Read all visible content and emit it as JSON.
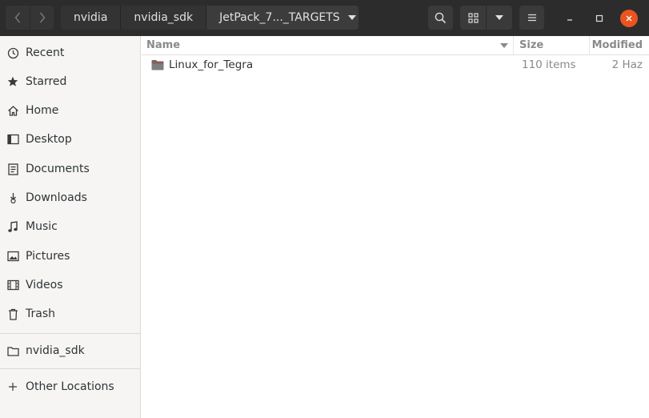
{
  "pathbar": {
    "crumbs": [
      "nvidia",
      "nvidia_sdk",
      "JetPack_7..._TARGETS"
    ]
  },
  "sidebar": {
    "items": [
      {
        "label": "Recent",
        "icon": "clock-icon"
      },
      {
        "label": "Starred",
        "icon": "star-icon"
      },
      {
        "label": "Home",
        "icon": "home-icon"
      },
      {
        "label": "Desktop",
        "icon": "desktop-icon"
      },
      {
        "label": "Documents",
        "icon": "document-icon"
      },
      {
        "label": "Downloads",
        "icon": "download-icon"
      },
      {
        "label": "Music",
        "icon": "music-icon"
      },
      {
        "label": "Pictures",
        "icon": "picture-icon"
      },
      {
        "label": "Videos",
        "icon": "video-icon"
      },
      {
        "label": "Trash",
        "icon": "trash-icon"
      }
    ],
    "bookmarks": [
      {
        "label": "nvidia_sdk",
        "icon": "folder-icon"
      }
    ],
    "other_locations": {
      "label": "Other Locations",
      "icon": "plus-icon"
    }
  },
  "list": {
    "columns": {
      "name": "Name",
      "size": "Size",
      "modified": "Modified"
    },
    "rows": [
      {
        "name": "Linux_for_Tegra",
        "size": "110 items",
        "modified": "2 Haz",
        "icon": "folder-icon"
      }
    ]
  },
  "colors": {
    "headerbar": "#2c2c2c",
    "close_button": "#e95420",
    "folder": "#6b6b6b",
    "sidebar_bg": "#f6f5f4"
  }
}
